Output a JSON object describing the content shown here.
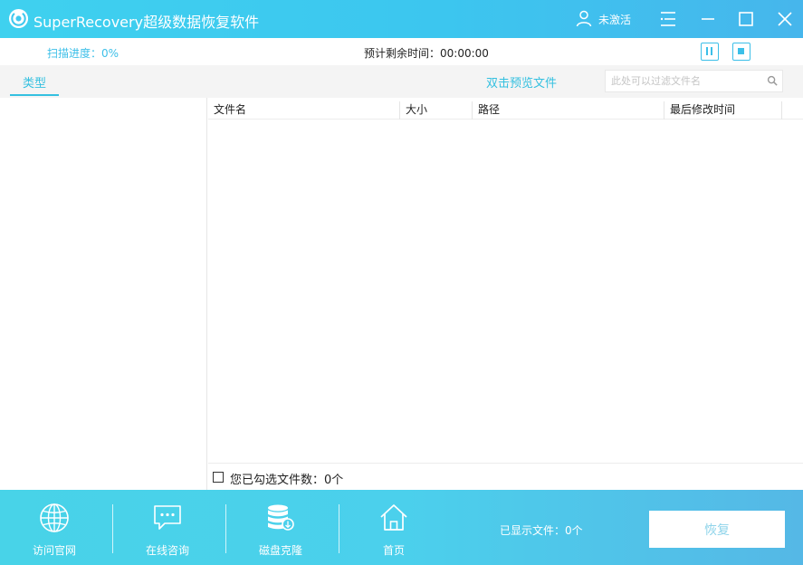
{
  "window": {
    "title": "SuperRecovery超级数据恢复软件",
    "user_status": "未激活"
  },
  "scan": {
    "progress_text": "扫描进度：0%",
    "remaining_text": "预计剩余时间：00:00:00"
  },
  "toolbar": {
    "tab_type": "类型",
    "preview_link": "双击预览文件",
    "filter_placeholder": "此处可以过滤文件名"
  },
  "table": {
    "columns": [
      "文件名",
      "大小",
      "路径",
      "最后修改时间"
    ],
    "rows": []
  },
  "selection": {
    "checked_text": "您已勾选文件数：0个"
  },
  "footer": {
    "items": [
      {
        "label": "访问官网",
        "icon": "globe-icon"
      },
      {
        "label": "在线咨询",
        "icon": "chat-icon"
      },
      {
        "label": "磁盘克隆",
        "icon": "disk-clone-icon"
      },
      {
        "label": "首页",
        "icon": "home-icon"
      }
    ],
    "shown_files": "已显示文件：0个",
    "recover_label": "恢复"
  },
  "colors": {
    "accent": "#34c0e0",
    "titlebar": "#3fc9ef",
    "footer": "#4bd0ec"
  }
}
